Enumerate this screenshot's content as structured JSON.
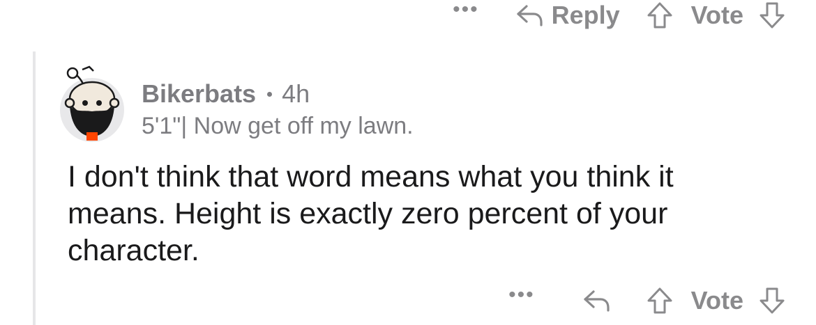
{
  "parent_actions": {
    "more_label": "•••",
    "reply_label": "Reply",
    "vote_label": "Vote"
  },
  "comment": {
    "author": "Bikerbats",
    "age": "4h",
    "flair": "5'1\"| Now get off my lawn.",
    "body": "I don't think that word means what you think it means.  Height is exactly zero percent of your character."
  },
  "comment_actions": {
    "more_label": "•••",
    "vote_label": "Vote"
  },
  "colors": {
    "muted": "#8a8a8c",
    "text": "#1a1a1b",
    "thread_line": "#e6e6e8",
    "avatar_bg": "#e8e8ea",
    "avatar_accent": "#ff4500"
  },
  "icons": {
    "reply": "reply-arrow-icon",
    "upvote": "upvote-arrow-icon",
    "downvote": "downvote-arrow-icon",
    "more": "more-dots-icon"
  }
}
